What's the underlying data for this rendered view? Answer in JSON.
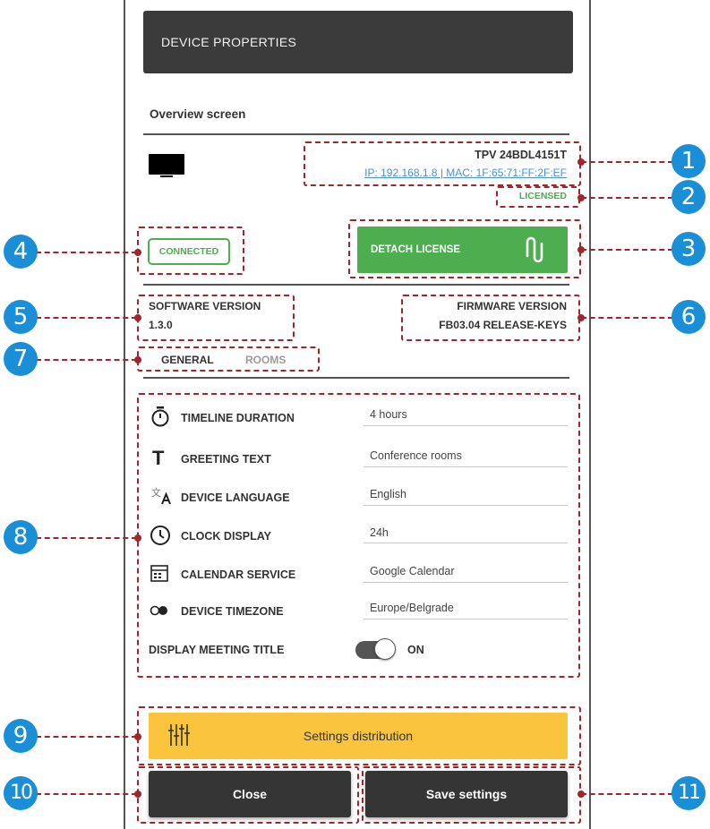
{
  "header": {
    "title": "DEVICE PROPERTIES"
  },
  "overview": {
    "title": "Overview screen"
  },
  "device": {
    "model": "TPV 24BDL4151T",
    "network": "IP: 192.168.1.8 | MAC: 1F:65:71:FF:2F:EF",
    "license_status": "LICENSED",
    "connection_status": "CONNECTED",
    "detach_label": "DETACH LICENSE",
    "software_label": "SOFTWARE VERSION",
    "software_value": "1.3.0",
    "firmware_label": "FIRMWARE VERSION",
    "firmware_value": "FB03.04 RELEASE-KEYS"
  },
  "tabs": [
    {
      "label": "GENERAL",
      "active": true
    },
    {
      "label": "ROOMS",
      "active": false
    }
  ],
  "settings": [
    {
      "icon": "stopwatch-icon",
      "label": "TIMELINE DURATION",
      "value": "4 hours"
    },
    {
      "icon": "text-icon",
      "label": "GREETING TEXT",
      "value": "Conference rooms"
    },
    {
      "icon": "translate-icon",
      "label": "DEVICE LANGUAGE",
      "value": "English"
    },
    {
      "icon": "clock-icon",
      "label": "CLOCK DISPLAY",
      "value": "24h"
    },
    {
      "icon": "calendar-icon",
      "label": "CALENDAR SERVICE",
      "value": "Google Calendar"
    },
    {
      "icon": "globe-icon",
      "label": "DEVICE TIMEZONE",
      "value": "Europe/Belgrade"
    }
  ],
  "meeting_title": {
    "label": "DISPLAY MEETING TITLE",
    "toggle_state": "ON"
  },
  "distribution": {
    "label": "Settings distribution"
  },
  "actions": {
    "close_label": "Close",
    "save_label": "Save settings"
  },
  "callouts": [
    "1",
    "2",
    "3",
    "4",
    "5",
    "6",
    "7",
    "8",
    "9",
    "10",
    "11"
  ],
  "colors": {
    "header_bg": "#3b3b3b",
    "license_green": "#4cae4f",
    "link_blue": "#4a90d9",
    "distribution_yellow": "#fbc43d",
    "callout_blue": "#1a8fd8",
    "annotation_red": "#a0262c"
  }
}
